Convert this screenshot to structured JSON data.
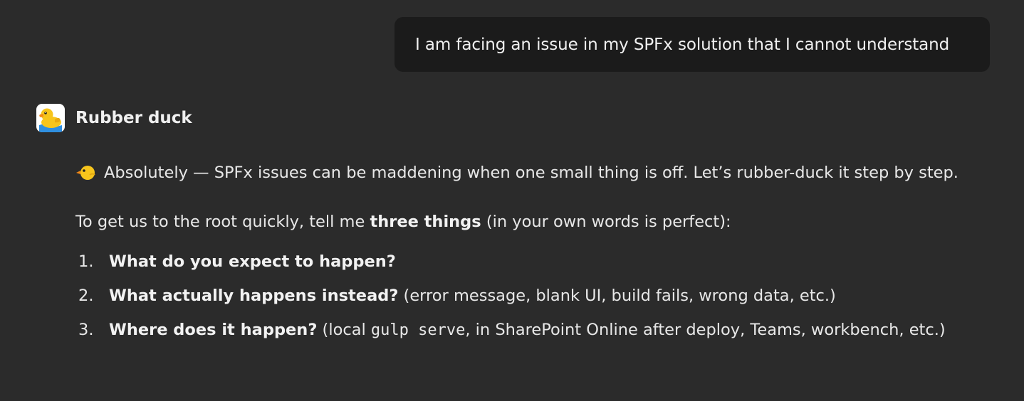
{
  "user_message": {
    "text": "I am facing an issue in my SPFx solution that I cannot understand"
  },
  "assistant": {
    "name": "Rubber duck",
    "avatar_icon": "rubber-duck-icon",
    "intro": "Absolutely — SPFx issues can be maddening when one small thing is off. Let’s rubber-duck it step by step.",
    "prompt_before": "To get us to the root quickly, tell me ",
    "prompt_bold": "three things",
    "prompt_after": " (in your own words is perfect):",
    "steps": [
      {
        "number": "1.",
        "bold": "What do you expect to happen?",
        "rest_before": "",
        "code": "",
        "rest_after": ""
      },
      {
        "number": "2.",
        "bold": "What actually happens instead?",
        "rest_before": " (error message, blank UI, build fails, wrong data, etc.)",
        "code": "",
        "rest_after": ""
      },
      {
        "number": "3.",
        "bold": "Where does it happen?",
        "rest_before": " (local ",
        "code": "gulp serve",
        "rest_after": ", in SharePoint Online after deploy, Teams, workbench, etc.)"
      }
    ]
  },
  "colors": {
    "background": "#2b2b2b",
    "user_bubble": "#1b1b1b",
    "text": "#e8e8e8"
  }
}
